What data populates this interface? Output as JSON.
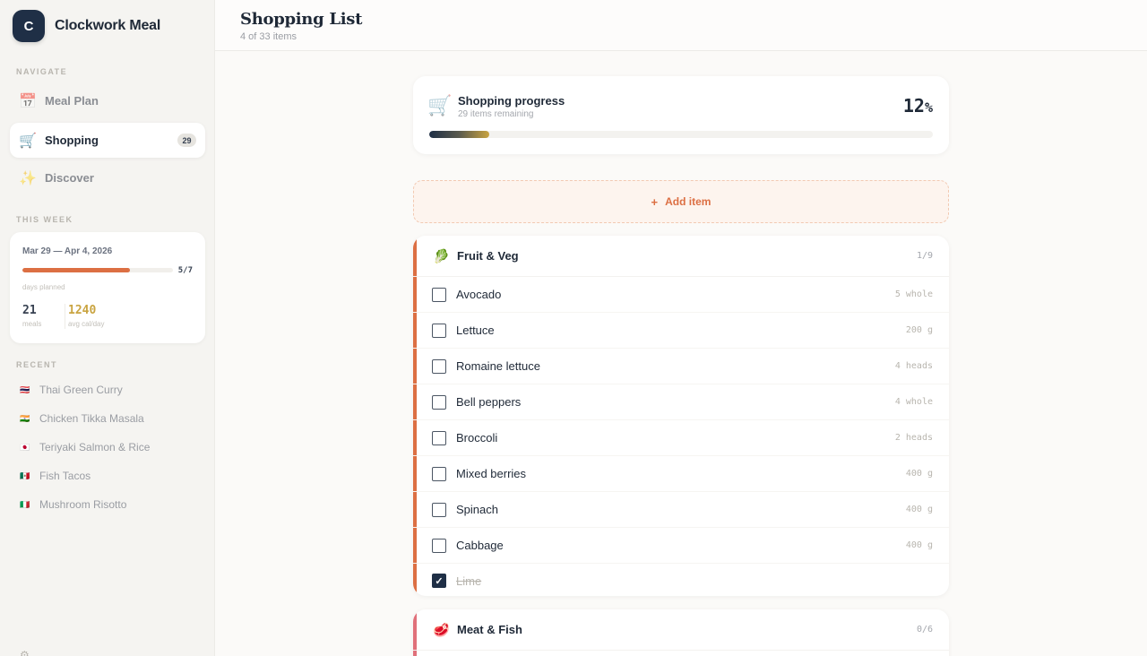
{
  "app": {
    "logo_letter": "C",
    "name": "Clockwork Meal"
  },
  "sidebar": {
    "navigate_label": "NAVIGATE",
    "nav": [
      {
        "icon": "📅",
        "label": "Meal Plan"
      },
      {
        "icon": "🛒",
        "label": "Shopping",
        "badge": "29"
      },
      {
        "icon": "✨",
        "label": "Discover"
      }
    ],
    "this_week_label": "THIS WEEK",
    "week": {
      "range": "Mar 29 — Apr 4, 2026",
      "planned": "5/7",
      "planned_fraction": 0.714,
      "planned_label": "days planned",
      "meals": "21",
      "meals_label": "meals",
      "avg_cal": "1240",
      "avg_cal_label": "avg cal/day",
      "accent": "#dc6f43",
      "cal_color": "#c9a441"
    },
    "recent_label": "RECENT",
    "recent": [
      {
        "flag": "🇹🇭",
        "label": "Thai Green Curry"
      },
      {
        "flag": "🇮🇳",
        "label": "Chicken Tikka Masala"
      },
      {
        "flag": "🇯🇵",
        "label": "Teriyaki Salmon & Rice"
      },
      {
        "flag": "🇲🇽",
        "label": "Fish Tacos"
      },
      {
        "flag": "🇮🇹",
        "label": "Mushroom Risotto"
      }
    ]
  },
  "header": {
    "title": "Shopping List",
    "subtitle": "4 of 33 items"
  },
  "progress": {
    "title": "Shopping progress",
    "subtitle": "29 items remaining",
    "percent": "12",
    "percent_sign": "%",
    "fraction": 0.12
  },
  "add_item": {
    "icon": "+",
    "label": "Add item"
  },
  "categories": [
    {
      "icon": "🥬",
      "name": "Fruit & Veg",
      "count": "1/9",
      "color": "#dc6f43",
      "items": [
        {
          "name": "Avocado",
          "qty": "5 whole",
          "checked": false
        },
        {
          "name": "Lettuce",
          "qty": "200 g",
          "checked": false
        },
        {
          "name": "Romaine lettuce",
          "qty": "4 heads",
          "checked": false
        },
        {
          "name": "Bell peppers",
          "qty": "4 whole",
          "checked": false
        },
        {
          "name": "Broccoli",
          "qty": "2 heads",
          "checked": false
        },
        {
          "name": "Mixed berries",
          "qty": "400 g",
          "checked": false
        },
        {
          "name": "Spinach",
          "qty": "400 g",
          "checked": false
        },
        {
          "name": "Cabbage",
          "qty": "400 g",
          "checked": false
        },
        {
          "name": "Lime",
          "qty": "",
          "checked": true
        }
      ]
    },
    {
      "icon": "🥩",
      "name": "Meat & Fish",
      "count": "0/6",
      "color": "#e0707a",
      "items": []
    }
  ]
}
